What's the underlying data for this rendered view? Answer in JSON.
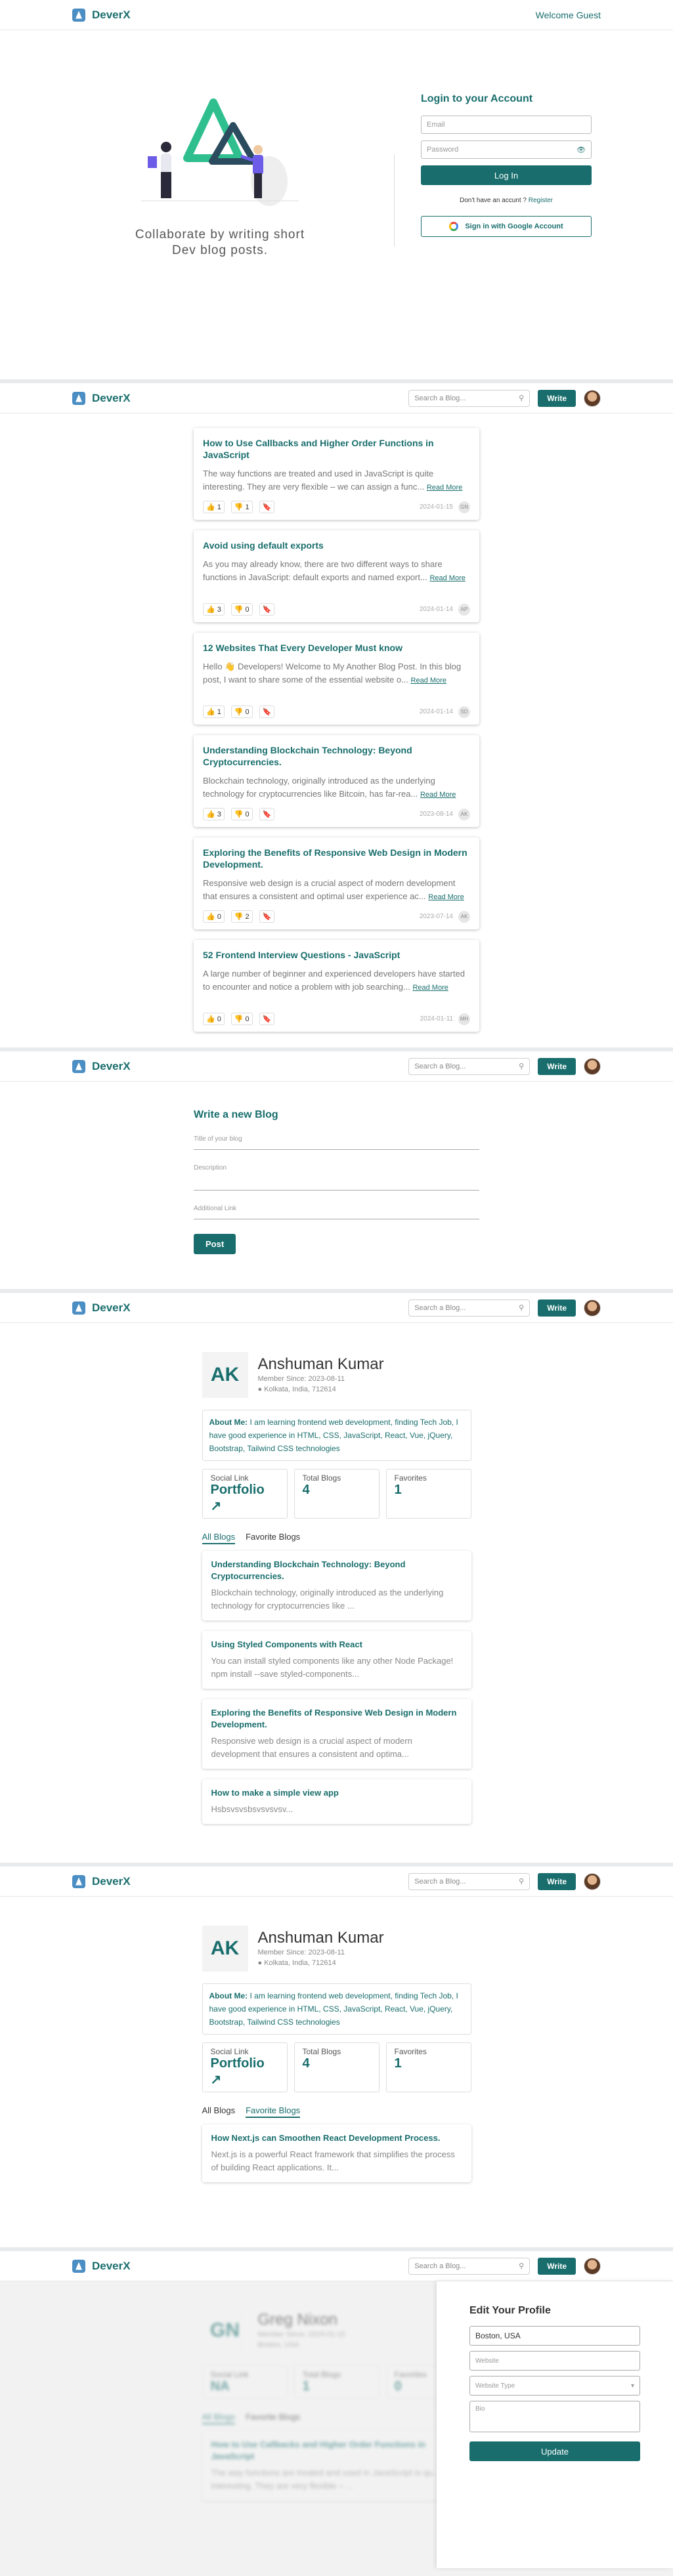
{
  "brand": "DeverX",
  "login": {
    "welcome": "Welcome Guest",
    "tagline1": "Collaborate by writing short",
    "tagline2": "Dev blog posts.",
    "title": "Login to your Account",
    "email_ph": "Email",
    "password_ph": "Password",
    "login_btn": "Log In",
    "signup_text": "Don't have an accunt ?",
    "register": "Register",
    "google": "Sign in with Google Account"
  },
  "nav": {
    "search_ph": "Search a Blog...",
    "write": "Write"
  },
  "feed": [
    {
      "title": "How to Use Callbacks and Higher Order Functions in JavaScript",
      "excerpt": "The way functions are treated and used in JavaScript is quite interesting. They are very flexible – we can assign a func...",
      "likes": "1",
      "dislikes": "1",
      "date": "2024-01-15",
      "initials": "GN"
    },
    {
      "title": "Avoid using default exports",
      "excerpt": "As you may already know, there are two different ways to share functions in JavaScript: default exports and named export...",
      "likes": "3",
      "dislikes": "0",
      "date": "2024-01-14",
      "initials": "AP"
    },
    {
      "title": "12 Websites That Every Developer Must know",
      "excerpt": "Hello 👋 Developers! Welcome to My Another Blog Post. In this blog post, I want to share some of the essential website o...",
      "likes": "1",
      "dislikes": "0",
      "date": "2024-01-14",
      "initials": "SD"
    },
    {
      "title": "Understanding Blockchain Technology: Beyond Cryptocurrencies.",
      "excerpt": "Blockchain technology, originally introduced as the underlying technology for cryptocurrencies like Bitcoin, has far-rea...",
      "likes": "3",
      "dislikes": "0",
      "date": "2023-08-14",
      "initials": "AK"
    },
    {
      "title": "Exploring the Benefits of Responsive Web Design in Modern Development.",
      "excerpt": "Responsive web design is a crucial aspect of modern development that ensures a consistent and optimal user experience ac...",
      "likes": "0",
      "dislikes": "2",
      "date": "2023-07-14",
      "initials": "AK"
    },
    {
      "title": "52 Frontend Interview Questions - JavaScript",
      "excerpt": "A large number of beginner and experienced developers have started to encounter and notice a problem with job searching...",
      "likes": "0",
      "dislikes": "0",
      "date": "2024-01-11",
      "initials": "MH"
    }
  ],
  "read_more": "Read More",
  "write": {
    "heading": "Write a new Blog",
    "title_ph": "Title of your blog",
    "desc_ph": "Description",
    "link_ph": "Additional Link",
    "post": "Post"
  },
  "profile": {
    "initials": "AK",
    "name": "Anshuman Kumar",
    "since": "Member Since: 2023-08-11",
    "location": "Kolkata, India, 712614",
    "about_label": "About Me:",
    "about": "I am learning frontend web development, finding Tech Job, I have good experience in HTML, CSS, JavaScript, React, Vue, jQuery, Bootstrap, Tailwind CSS technologies",
    "social_label": "Social Link",
    "social": "Portfolio",
    "blogs_label": "Total Blogs",
    "blogs": "4",
    "fav_label": "Favorites",
    "fav": "1",
    "tab_all": "All Blogs",
    "tab_fav": "Favorite Blogs",
    "blogs_list": [
      {
        "title": "Understanding Blockchain Technology: Beyond Cryptocurrencies.",
        "excerpt": "Blockchain technology, originally introduced as the underlying technology for cryptocurrencies like ..."
      },
      {
        "title": "Using Styled Components with React",
        "excerpt": "You can install styled components like any other Node Package! npm install --save styled-components..."
      },
      {
        "title": "Exploring the Benefits of Responsive Web Design in Modern Development.",
        "excerpt": "Responsive web design is a crucial aspect of modern development that ensures a consistent and optima..."
      },
      {
        "title": "How to make a simple view app",
        "excerpt": "Hsbsvsvsbsvsvsvsv..."
      }
    ],
    "fav_list": [
      {
        "title": "How Next.js can Smoothen React Development Process.",
        "excerpt": "Next.js is a powerful React framework that simplifies the process of building React applications. It..."
      }
    ]
  },
  "edit": {
    "bg_initials": "GN",
    "bg_name": "Greg Nixon",
    "bg_since": "Member Since: 2024-01-15",
    "bg_location": "Boston, USA",
    "bg_social": "NA",
    "bg_blogs": "1",
    "bg_fav": "0",
    "bg_blog_title": "How to Use Callbacks and Higher Order Functions in JavaScript",
    "bg_blog_excerpt": "The way functions are treated and used in JavaScript is qu... interesting. They are very flexible – ...",
    "heading": "Edit Your Profile",
    "location": "Boston, USA",
    "website_ph": "Website",
    "type_ph": "Website Type",
    "bio_ph": "Bio",
    "update": "Update"
  }
}
